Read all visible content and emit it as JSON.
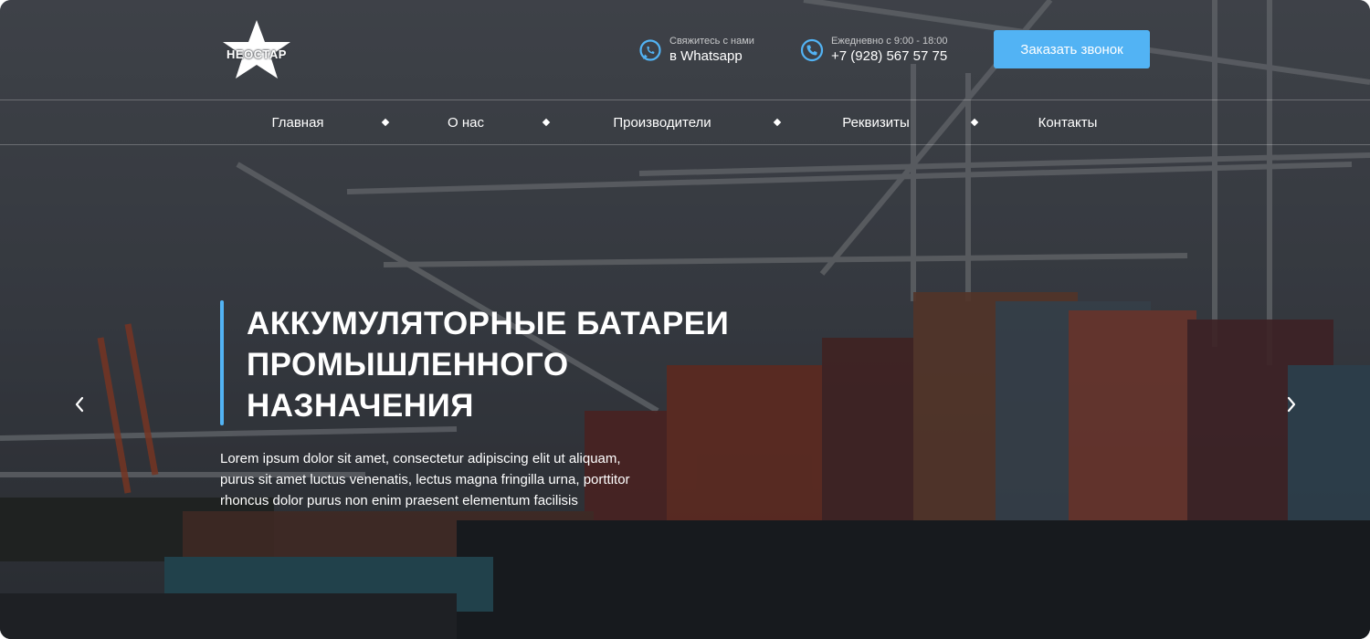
{
  "brand": {
    "logo_text": "НЕОСТАР"
  },
  "contacts": {
    "whatsapp": {
      "caption": "Свяжитесь с нами",
      "value": "в Whatsapp",
      "icon": "whatsapp-icon"
    },
    "phone": {
      "caption": "Ежедневно с 9:00 - 18:00",
      "value": "+7 (928) 567 57 75",
      "icon": "phone-icon"
    }
  },
  "cta": {
    "label": "Заказать звонок"
  },
  "nav": {
    "items": [
      {
        "label": "Главная"
      },
      {
        "label": "О нас"
      },
      {
        "label": "Производители"
      },
      {
        "label": "Реквизиты"
      },
      {
        "label": "Контакты"
      }
    ]
  },
  "hero": {
    "title_lines": [
      "АККУМУЛЯТОРНЫЕ БАТАРЕИ",
      "ПРОМЫШЛЕННОГО",
      "НАЗНАЧЕНИЯ"
    ],
    "description_lines": [
      "Lorem ipsum dolor sit amet, consectetur adipiscing elit ut aliquam,",
      "purus sit amet luctus venenatis, lectus magna fringilla urna, porttitor",
      "rhoncus dolor purus non enim praesent elementum facilisis"
    ]
  },
  "slider": {
    "prev_icon": "chevron-left-icon",
    "next_icon": "chevron-right-icon"
  },
  "colors": {
    "accent": "#52b3f4",
    "text": "#ffffff"
  }
}
